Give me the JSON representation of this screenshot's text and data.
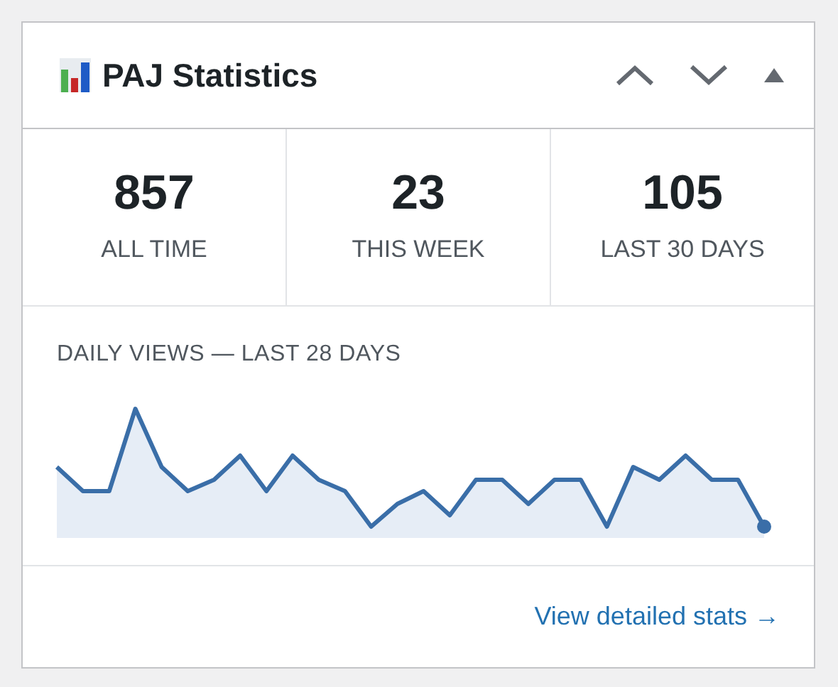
{
  "widget": {
    "title": "PAJ Statistics",
    "controls": [
      {
        "kind": "up"
      },
      {
        "kind": "down"
      },
      {
        "kind": "toggle"
      }
    ]
  },
  "stats": [
    {
      "value": "857",
      "label": "ALL TIME"
    },
    {
      "value": "23",
      "label": "THIS WEEK"
    },
    {
      "value": "105",
      "label": "LAST 30 DAYS"
    }
  ],
  "chart": {
    "title": "DAILY VIEWS — LAST 28 DAYS"
  },
  "footer": {
    "link": "View detailed stats →"
  }
}
